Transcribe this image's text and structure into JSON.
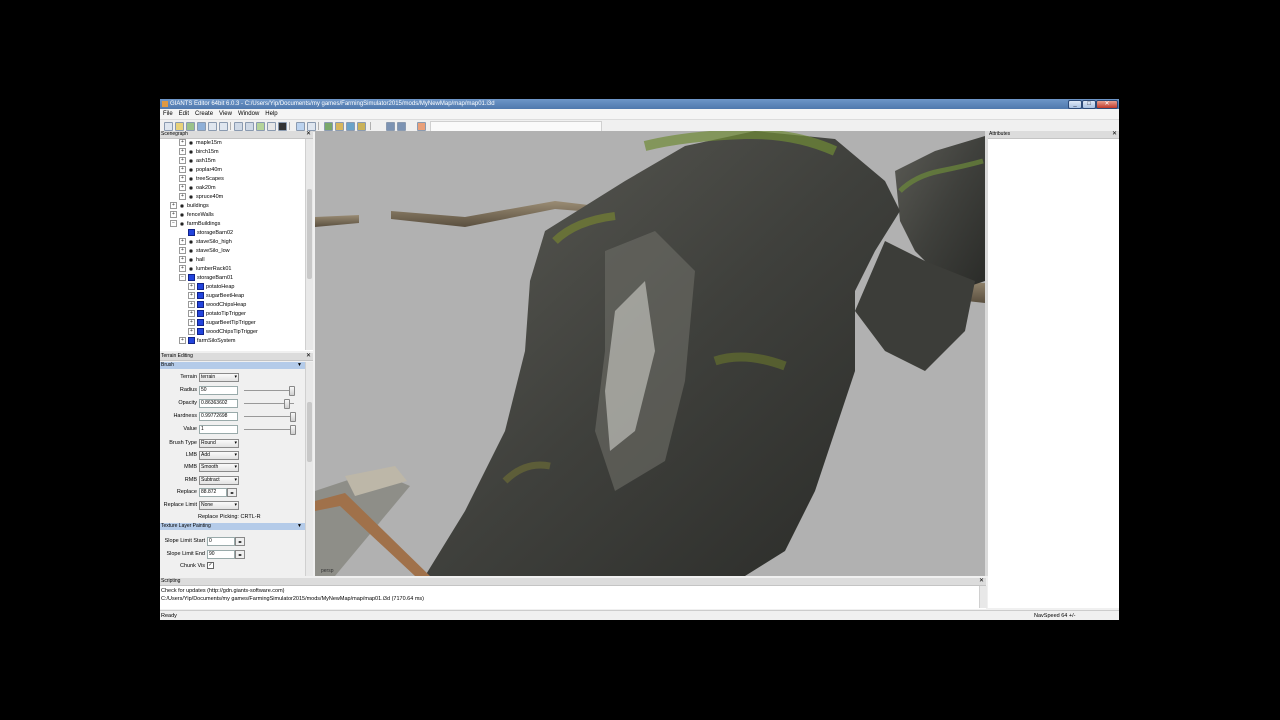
{
  "window": {
    "title": "GIANTS Editor 64bit 6.0.3 - C:/Users/Yip/Documents/my games/FarmingSimulator2015/mods/MyNewMap/map/map01.i3d",
    "minimize": "_",
    "maximize": "□",
    "close": "✕"
  },
  "menu": {
    "file": "File",
    "edit": "Edit",
    "create": "Create",
    "view": "View",
    "window": "Window",
    "help": "Help"
  },
  "scenegraph": {
    "title": "Scenegraph",
    "close": "✕",
    "items": [
      {
        "label": "maple15m",
        "expander": "+",
        "icon": "transform-group-icon"
      },
      {
        "label": "birch15m",
        "expander": "+",
        "icon": "transform-group-icon"
      },
      {
        "label": "ash15m",
        "expander": "+",
        "icon": "transform-group-icon"
      },
      {
        "label": "poplar40m",
        "expander": "+",
        "icon": "transform-group-icon"
      },
      {
        "label": "treeScapes",
        "expander": "+",
        "icon": "transform-group-icon"
      },
      {
        "label": "oak20m",
        "expander": "+",
        "icon": "transform-group-icon"
      },
      {
        "label": "spruce40m",
        "expander": "+",
        "icon": "transform-group-icon"
      },
      {
        "label": "buildings",
        "expander": "+",
        "icon": "transform-group-icon"
      },
      {
        "label": "fenceWalls",
        "expander": "+",
        "icon": "transform-group-icon"
      },
      {
        "label": "farmBuildings",
        "expander": "−",
        "icon": "transform-group-icon"
      },
      {
        "label": "storageBarn02",
        "expander": "",
        "icon": "shape-icon"
      },
      {
        "label": "staveSilo_high",
        "expander": "+",
        "icon": "transform-group-icon"
      },
      {
        "label": "staveSilo_low",
        "expander": "+",
        "icon": "transform-group-icon"
      },
      {
        "label": "hall",
        "expander": "+",
        "icon": "transform-group-icon"
      },
      {
        "label": "lumberRack01",
        "expander": "+",
        "icon": "transform-group-icon"
      },
      {
        "label": "storageBarn01",
        "expander": "−",
        "icon": "shape-icon"
      },
      {
        "label": "potatoHeap",
        "expander": "+",
        "icon": "shape-icon"
      },
      {
        "label": "sugarBeetHeap",
        "expander": "+",
        "icon": "shape-icon"
      },
      {
        "label": "woodChipsHeap",
        "expander": "+",
        "icon": "shape-icon"
      },
      {
        "label": "potatoTipTrigger",
        "expander": "+",
        "icon": "shape-icon"
      },
      {
        "label": "sugarBeetTipTrigger",
        "expander": "+",
        "icon": "shape-icon"
      },
      {
        "label": "woodChipsTipTrigger",
        "expander": "+",
        "icon": "shape-icon"
      },
      {
        "label": "farmSiloSystem",
        "expander": "+",
        "icon": "shape-icon"
      }
    ]
  },
  "terrain_editing": {
    "title": "Terrain Editing",
    "close": "✕",
    "brush_section": "Brush",
    "terrain_label": "Terrain",
    "terrain_value": "terrain",
    "radius_label": "Radius",
    "radius_value": "50",
    "radius_level": 0.97,
    "opacity_label": "Opacity",
    "opacity_value": "0.86363602",
    "opacity_level": 0.86,
    "hardness_label": "Hardness",
    "hardness_value": "0.99772698",
    "hardness_level": 0.99,
    "value_label": "Value",
    "value_value": "1",
    "value_level": 1.0,
    "brush_type_label": "Brush Type",
    "brush_type_value": "Round",
    "lmb_label": "LMB",
    "lmb_value": "Add",
    "mmb_label": "MMB",
    "mmb_value": "Smooth",
    "rmb_label": "RMB",
    "rmb_value": "Subtract",
    "replace_label": "Replace",
    "replace_value": "88.872",
    "replace_limit_label": "Replace Limit",
    "replace_limit_value": "None",
    "replace_picking": "Replace Picking: CRTL-R",
    "texture_section": "Texture Layer Painting",
    "slope_start_label": "Slope Limit Start",
    "slope_start_value": "0",
    "slope_end_label": "Slope Limit End",
    "slope_end_value": "90",
    "chunk_vis_label": "Chunk Vis"
  },
  "attributes": {
    "title": "Attributes",
    "close": "✕"
  },
  "viewport": {
    "camera_label": "persp"
  },
  "scripting": {
    "title": "Scripting",
    "close": "✕",
    "lines": [
      "Check for updates (http://gdn.giants-software.com)",
      "C:/Users/Yip/Documents/my games/FarmingSimulator2015/mods/MyNewMap/map/map01.i3d (7170.64 ms)"
    ]
  },
  "status": {
    "left": "Ready",
    "right": "NavSpeed 64 +/-"
  },
  "colors": {
    "titlebar": "#5a82b8",
    "section_header": "#b4cbe9",
    "viewport_bg": "#b2b2b2"
  }
}
